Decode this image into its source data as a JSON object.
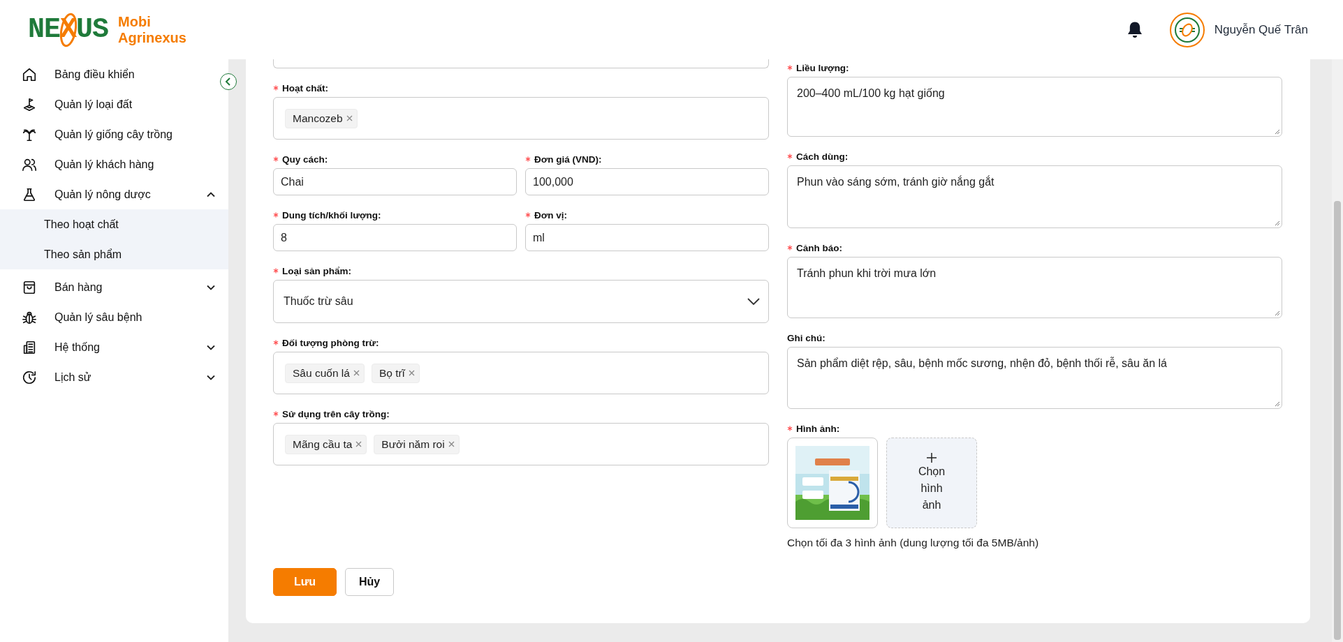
{
  "header": {
    "brand": {
      "wordmark": "NEXUS",
      "name_line1": "Mobi",
      "name_line2": "Agrinexus"
    },
    "user_name": "Nguyễn Quế Trân"
  },
  "sidebar": {
    "items": [
      {
        "label": "Bảng điều khiển"
      },
      {
        "label": "Quản lý loại đất"
      },
      {
        "label": "Quản lý giống cây trồng"
      },
      {
        "label": "Quản lý khách hàng"
      },
      {
        "label": "Quản lý nông dược",
        "expanded": true,
        "children": [
          {
            "label": "Theo hoạt chất",
            "selected": false
          },
          {
            "label": "Theo sản phẩm",
            "selected": false
          }
        ]
      },
      {
        "label": "Bán hàng",
        "expanded": false
      },
      {
        "label": "Quản lý sâu bệnh"
      },
      {
        "label": "Hệ thống",
        "expanded": false
      },
      {
        "label": "Lịch sử",
        "expanded": false
      }
    ]
  },
  "form": {
    "left": [
      {
        "kind": "partial"
      },
      {
        "kind": "tags",
        "label": "Hoạt chất:",
        "required": true,
        "tags": [
          "Mancozeb"
        ]
      },
      {
        "kind": "row",
        "fields": [
          {
            "kind": "input",
            "label": "Quy cách:",
            "required": true,
            "value": "Chai"
          },
          {
            "kind": "input",
            "label": "Đơn giá (VND):",
            "required": true,
            "value": "100,000"
          }
        ]
      },
      {
        "kind": "row",
        "fields": [
          {
            "kind": "input",
            "label": "Dung tích/khối lượng:",
            "required": true,
            "value": "8"
          },
          {
            "kind": "input",
            "label": "Đơn vị:",
            "required": true,
            "value": "ml"
          }
        ]
      },
      {
        "kind": "select",
        "label": "Loại sản phẩm:",
        "required": true,
        "value": "Thuốc trừ sâu"
      },
      {
        "kind": "tags",
        "label": "Đối tượng phòng trừ:",
        "required": true,
        "tags": [
          "Sâu cuốn lá",
          "Bọ trĩ"
        ]
      },
      {
        "kind": "tags",
        "label": "Sử dụng trên cây trồng:",
        "required": true,
        "tags": [
          "Mãng cầu ta",
          "Bưởi năm roi"
        ]
      }
    ],
    "right": [
      {
        "kind": "textarea",
        "label": "Liều lượng:",
        "required": true,
        "value": "200–400 mL/100 kg hạt giống"
      },
      {
        "kind": "textarea",
        "label": "Cách dùng:",
        "required": true,
        "value": "Phun vào sáng sớm, tránh giờ nắng gắt"
      },
      {
        "kind": "textarea",
        "label": "Cảnh báo:",
        "required": true,
        "value": "Tránh phun khi trời mưa lớn"
      },
      {
        "kind": "textarea",
        "label": "Ghi chú:",
        "required": false,
        "value": "Sản phẩm diệt rệp, sâu, bệnh mốc sương, nhện đỏ, bệnh thối rễ, sâu ăn lá"
      },
      {
        "kind": "images",
        "label": "Hình ảnh:",
        "required": true,
        "add_label": "Chọn hình ảnh",
        "hint": "Chọn tối đa 3 hình ảnh (dung lượng tối đa 5MB/ảnh)"
      }
    ],
    "buttons": [
      {
        "label": "Lưu",
        "kind": "primary"
      },
      {
        "label": "Hủy",
        "kind": "default"
      }
    ]
  }
}
